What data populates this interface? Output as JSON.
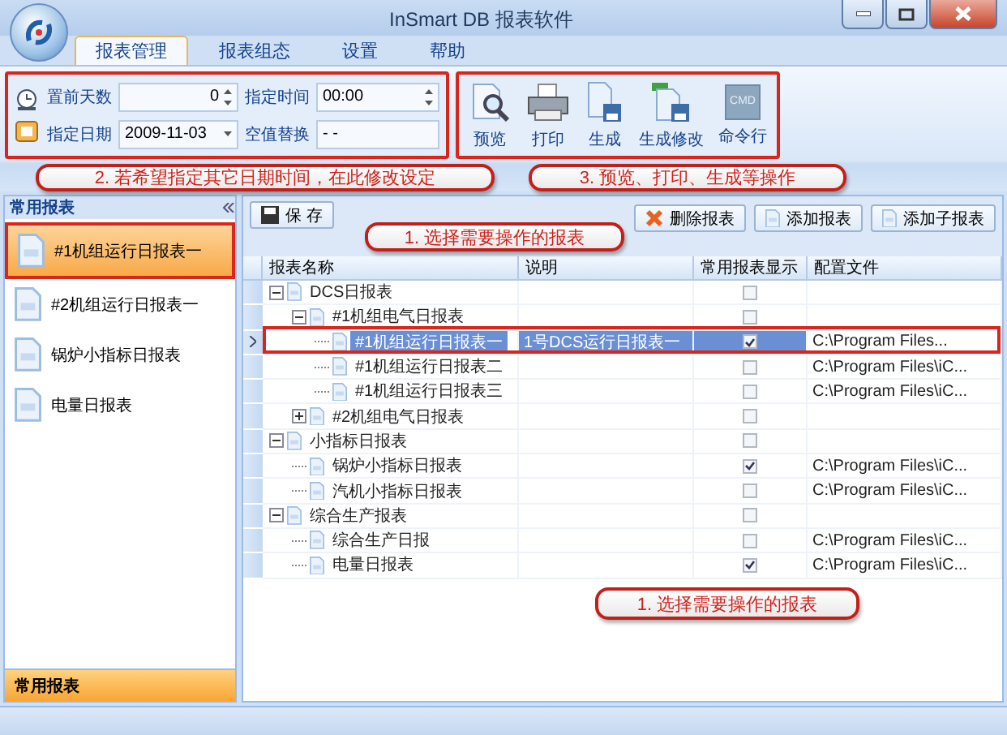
{
  "window": {
    "title": "InSmart DB 报表软件"
  },
  "tabs": [
    {
      "label": "报表管理",
      "selected": true
    },
    {
      "label": "报表组态",
      "selected": false
    },
    {
      "label": "设置",
      "selected": false
    },
    {
      "label": "帮助",
      "selected": false
    }
  ],
  "settings": {
    "days_label": "置前天数",
    "days_value": "0",
    "time_label": "指定时间",
    "time_value": "00:00",
    "date_label": "指定日期",
    "date_value": "2009-11-03",
    "null_label": "空值替换",
    "null_value": "- -"
  },
  "actions": [
    {
      "kind": "preview",
      "label": "预览"
    },
    {
      "kind": "print",
      "label": "打印"
    },
    {
      "kind": "generate",
      "label": "生成"
    },
    {
      "kind": "generate_edit",
      "label": "生成修改"
    },
    {
      "kind": "cmd",
      "label": "命令行",
      "icon_text": "CMD"
    }
  ],
  "sidebar": {
    "title": "常用报表",
    "items": [
      {
        "label": "#1机组运行日报表一",
        "selected": true
      },
      {
        "label": "#2机组运行日报表一",
        "selected": false
      },
      {
        "label": "锅炉小指标日报表",
        "selected": false
      },
      {
        "label": "电量日报表",
        "selected": false
      }
    ],
    "footer": "常用报表"
  },
  "toolbar": {
    "save": "保 存",
    "delete": "删除报表",
    "add": "添加报表",
    "add_child": "添加子报表"
  },
  "table": {
    "columns": [
      "报表名称",
      "说明",
      "常用报表显示",
      "配置文件"
    ],
    "rows": [
      {
        "name": "DCS日报表",
        "checked": false,
        "expanded": true,
        "selected": false,
        "children": [
          {
            "name": "#1机组电气日报表",
            "checked": false,
            "expanded": true,
            "selected": false,
            "children": [
              {
                "name": "#1机组运行日报表一",
                "description": "1号DCS运行日报表一",
                "checked": true,
                "config": "C:\\Program Files...",
                "selected": true
              },
              {
                "name": "#1机组运行日报表二",
                "checked": false,
                "config": "C:\\Program Files\\iC...",
                "selected": false
              },
              {
                "name": "#1机组运行日报表三",
                "checked": false,
                "config": "C:\\Program Files\\iC...",
                "selected": false
              }
            ]
          },
          {
            "name": "#2机组电气日报表",
            "checked": false,
            "expanded": false,
            "selected": false
          }
        ]
      },
      {
        "name": "小指标日报表",
        "checked": false,
        "expanded": true,
        "selected": false,
        "children": [
          {
            "name": "锅炉小指标日报表",
            "checked": true,
            "config": "C:\\Program Files\\iC...",
            "selected": false
          },
          {
            "name": "汽机小指标日报表",
            "checked": false,
            "config": "C:\\Program Files\\iC...",
            "selected": false
          }
        ]
      },
      {
        "name": "综合生产报表",
        "checked": false,
        "expanded": true,
        "selected": false,
        "children": [
          {
            "name": "综合生产日报",
            "checked": false,
            "config": "C:\\Program Files\\iC...",
            "selected": false
          },
          {
            "name": "电量日报表",
            "checked": true,
            "config": "C:\\Program Files\\iC...",
            "selected": false
          }
        ]
      }
    ]
  },
  "callouts": [
    "2. 若希望指定其它日期时间，在此修改设定",
    "3. 预览、打印、生成等操作",
    "1. 选择需要操作的报表",
    "1. 选择需要操作的报表"
  ]
}
